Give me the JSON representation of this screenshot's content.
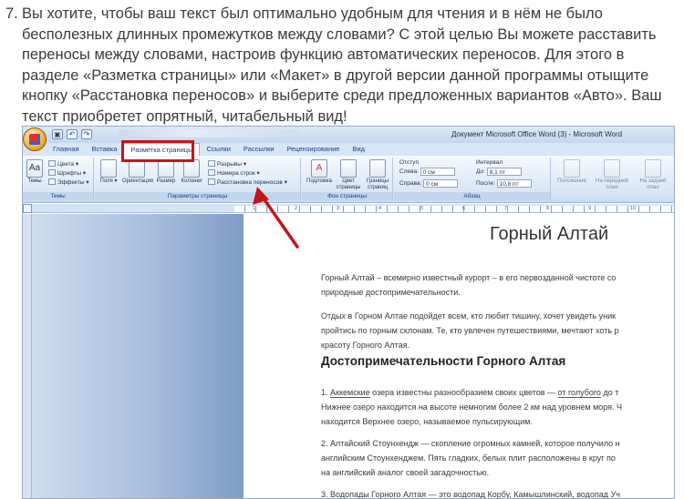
{
  "intro": {
    "number": "7.",
    "text": "Вы хотите, чтобы ваш текст был оптимально удобным для чтения и в нём не было бесполезных длинных промежутков между словами? С этой целью Вы можете расставить переносы между словами, настроив функцию автоматических переносов. Для этого в разделе «Разметка страницы» или «Макет» в другой версии данной программы отыщите кнопку «Расстановка переносов» и выберите среди предложенных вариантов «Авто». Ваш текст приобретет опрятный, читабельный вид!"
  },
  "window": {
    "title": "Документ Microsoft Office Word (3) - Microsoft Word"
  },
  "tabs": [
    "Главная",
    "Вставка",
    "Разметка страницы",
    "Ссылки",
    "Рассылки",
    "Рецензирование",
    "Вид"
  ],
  "ribbon": {
    "themes": {
      "big": "Темы",
      "colors": "Цвета",
      "fonts": "Шрифты",
      "effects": "Эффекты",
      "label": "Темы"
    },
    "page_setup": {
      "fields": "Поля",
      "orientation": "Ориентация",
      "size": "Размер",
      "columns": "Колонки",
      "breaks": "Разрывы",
      "line_numbers": "Номера строк",
      "hyphenation": "Расстановка переносов",
      "label": "Параметры страницы"
    },
    "page_background": {
      "watermark": "Подложка",
      "page_color_1": "Цвет",
      "page_color_2": "страницы",
      "borders_1": "Границы",
      "borders_2": "страниц",
      "label": "Фон страницы"
    },
    "paragraph": {
      "indent": "Отступ",
      "left_label": "Слева:",
      "left_value": "0 см",
      "right_label": "Справа:",
      "right_value": "0 см",
      "spacing": "Интервал",
      "before_label": "До:",
      "before_value": "8,1 пт",
      "after_label": "После:",
      "after_value": "10,8 пт",
      "label": "Абзац"
    },
    "arrange": {
      "position": "Положение",
      "front_1": "На передний",
      "front_2": "план",
      "back_1": "На задний",
      "back_2": "план"
    }
  },
  "ruler_numbers": [
    "1",
    "2",
    "3",
    "4",
    "5",
    "6",
    "7",
    "8",
    "9",
    "10"
  ],
  "document": {
    "title": "Горный Алтай",
    "p1_l1": "Горный Алтай – всемирно известный курорт – в его первозданной чистоте со",
    "p1_l2": "природные достопримечательности.",
    "p2_l1": "Отдых в Горном Алтае подойдет всем, кто любит тишину, хочет увидеть уник",
    "p2_l2": "пройтись по горным склонам. Те, кто увлечен путешествиями, мечтают хоть р",
    "p2_l3": "красоту Горного Алтая.",
    "heading": "Достопримечательности  Горного Алтая",
    "p3_l1_a": "1. ",
    "p3_l1_b": "Аккемские",
    "p3_l1_c": " озера известны разнообразием своих цветов — ",
    "p3_l1_d": "от голубого",
    "p3_l1_e": " до т",
    "p3_l2": "Нижнее озеро находится на высоте немногим более 2 км над уровнем моря. Ч",
    "p3_l3": "находится Верхнее озеро, называемое пульсирующим.",
    "p4_l1": "2. Алтайский Стоунхендж — скопление огромных камней, которое получило н",
    "p4_l2": "английским Стоунхенджем. Пять гладких, белых плит расположены в круг по",
    "p4_l3": "на английский аналог своей загадочностью.",
    "p5_a": "3. Водопады Горного Алтая — это водопад ",
    "p5_b": "Корбу",
    "p5_c": ", ",
    "p5_d": "Камышлинский",
    "p5_e": ", водопад ",
    "p5_f": "Уч"
  },
  "colors": {
    "highlight_box": "#c3161c",
    "arrow": "#c3161c",
    "tab_text": "#15428b"
  }
}
